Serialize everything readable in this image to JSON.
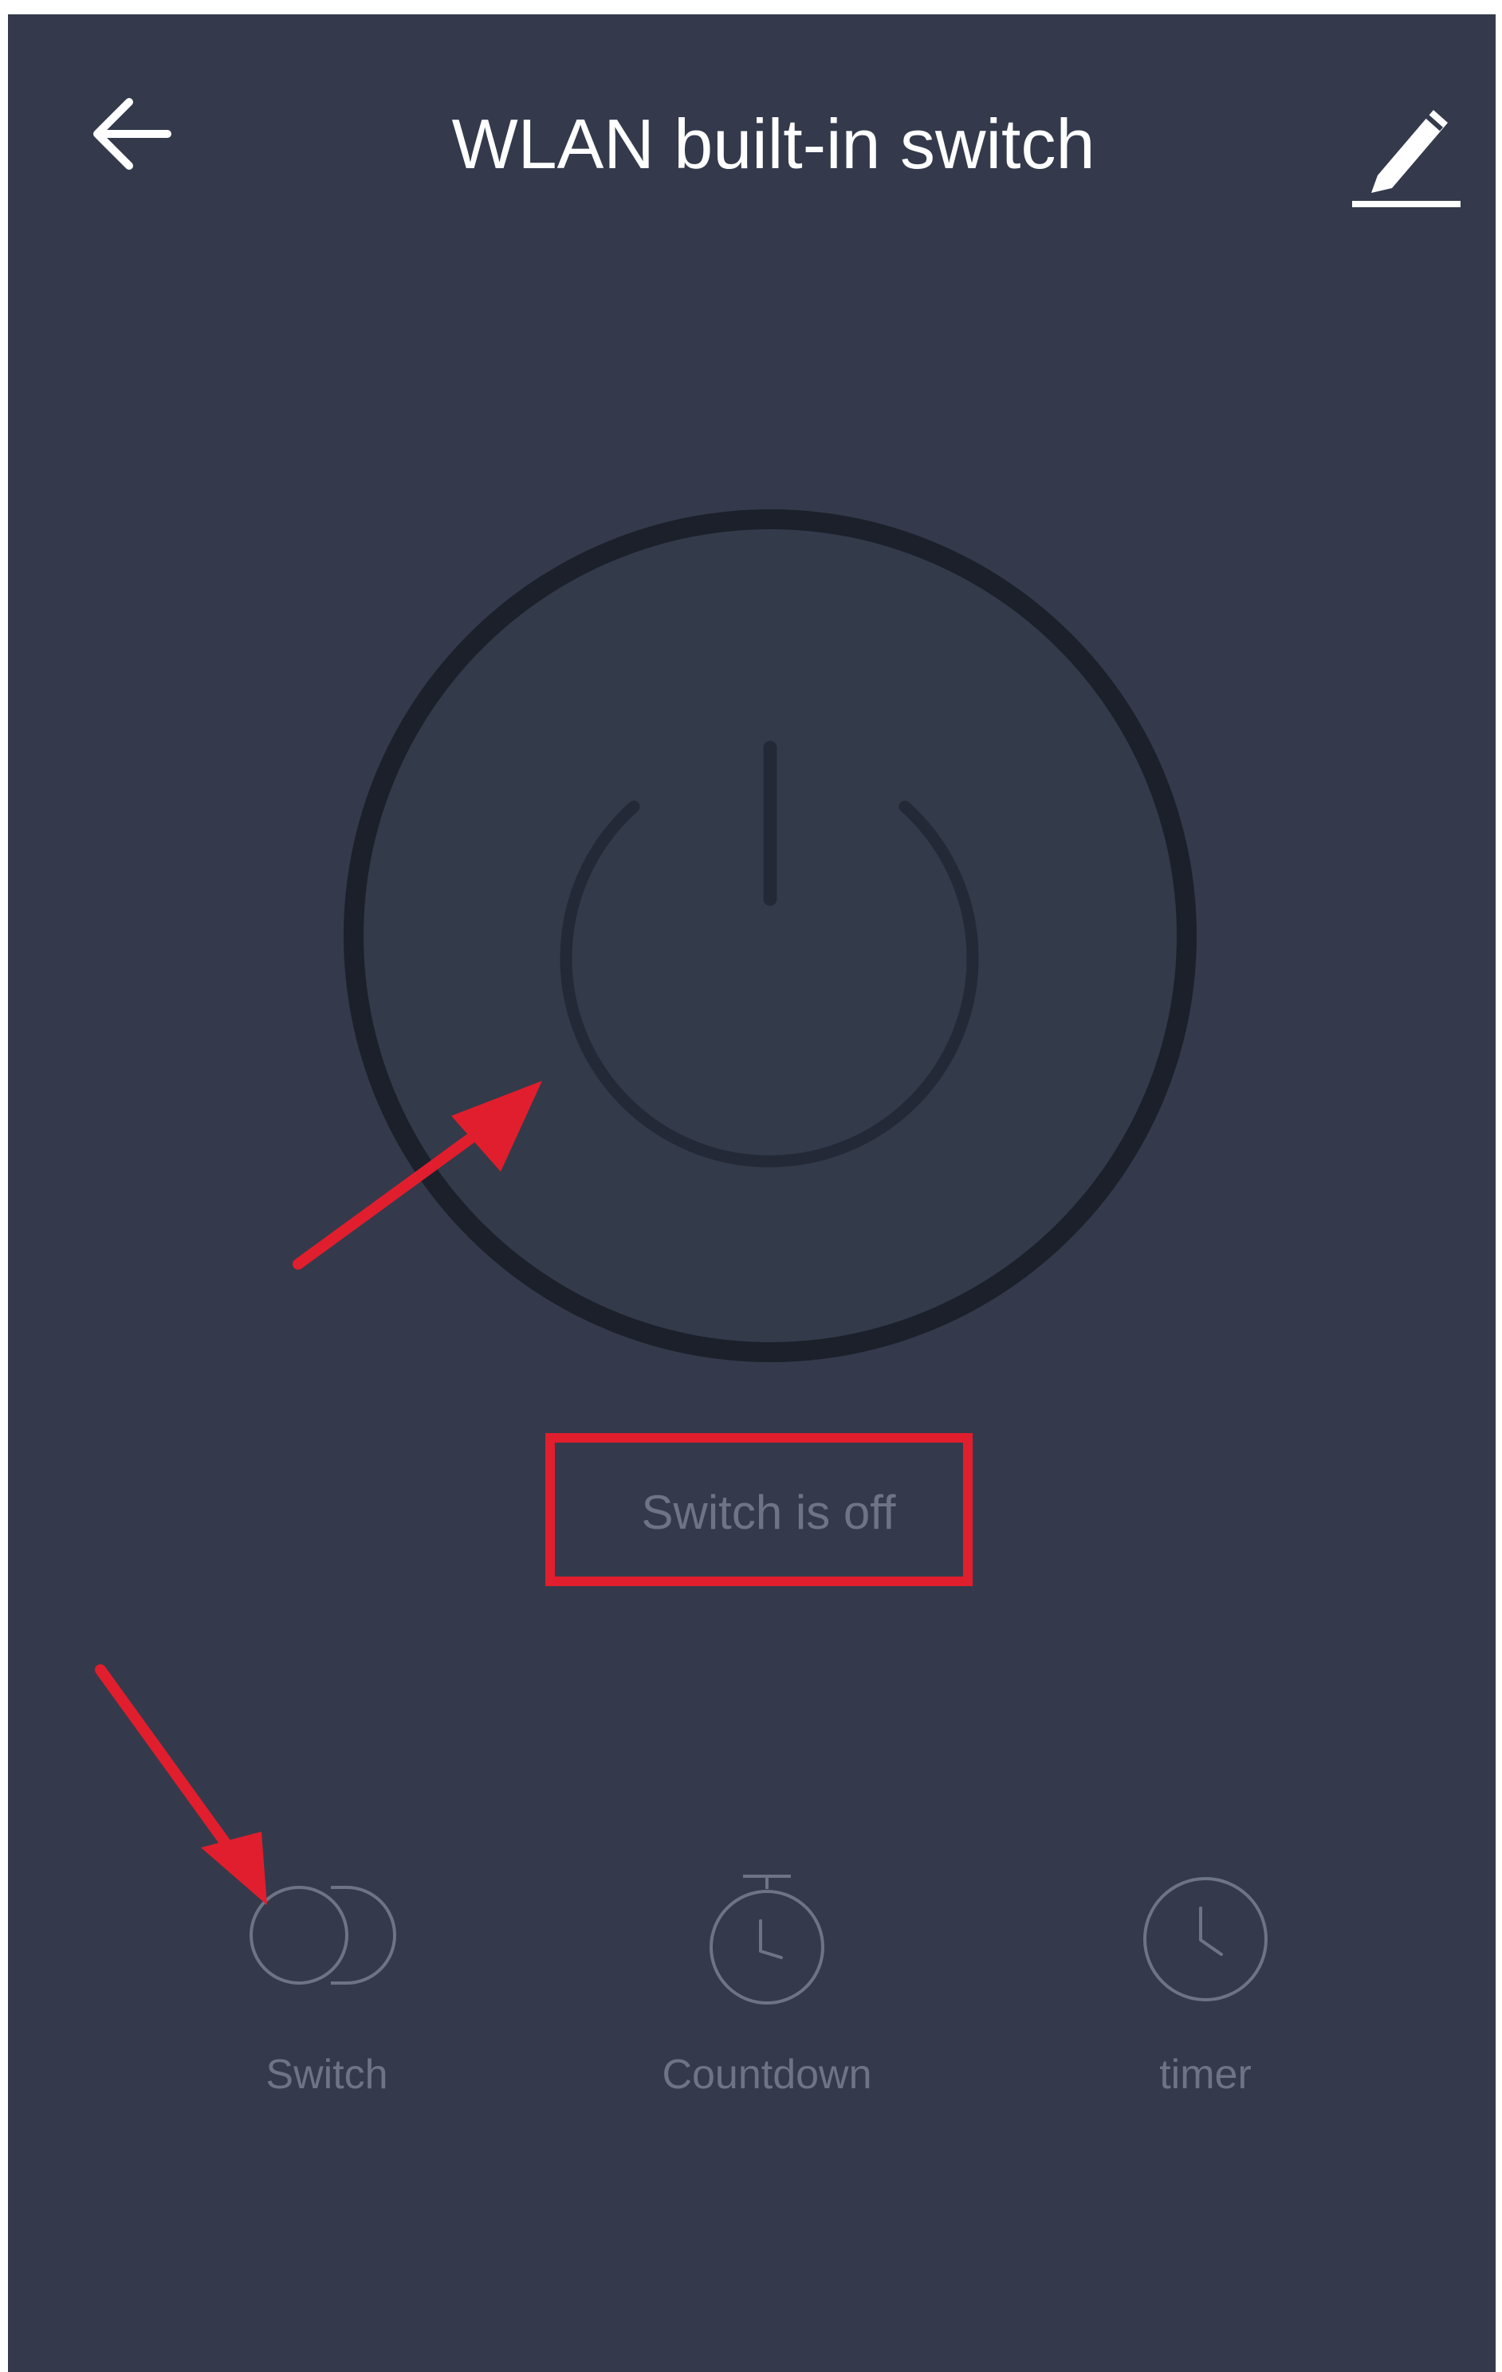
{
  "header": {
    "title": "WLAN built-in switch",
    "back_icon": "arrow-left-icon",
    "edit_icon": "pencil-icon"
  },
  "main": {
    "power_icon": "power-icon",
    "status_text": "Switch is off"
  },
  "toolbar": {
    "items": [
      {
        "label": "Switch",
        "icon": "toggle-circles-icon"
      },
      {
        "label": "Countdown",
        "icon": "stopwatch-icon"
      },
      {
        "label": "timer",
        "icon": "clock-icon"
      }
    ]
  },
  "colors": {
    "background": "#343a4b",
    "ring": "#1b202b",
    "power_glyph": "#232936",
    "muted_text": "#6d7486",
    "annotation_red": "#e11e2d"
  }
}
